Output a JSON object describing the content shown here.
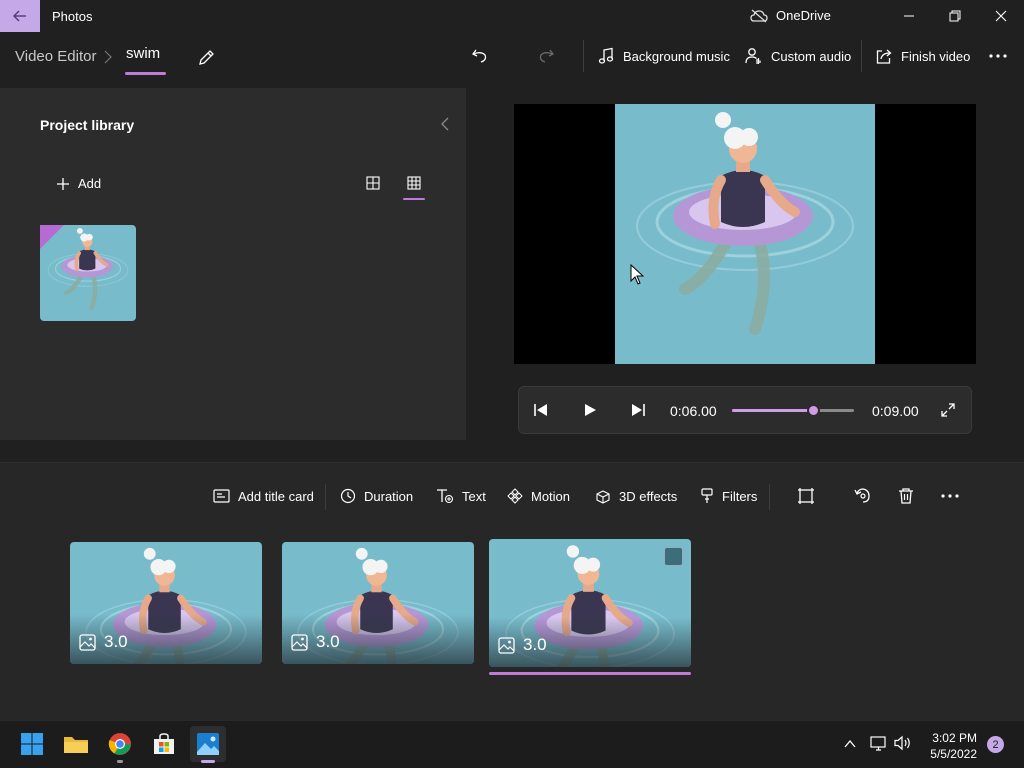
{
  "titlebar": {
    "app_title": "Photos",
    "onedrive_label": "OneDrive"
  },
  "breadcrumb": {
    "root": "Video Editor",
    "current": "swim"
  },
  "toolbar": {
    "background_music": "Background music",
    "custom_audio": "Custom audio",
    "finish_video": "Finish video"
  },
  "library": {
    "title": "Project library",
    "add_label": "Add"
  },
  "playback": {
    "current_time": "0:06.00",
    "total_time": "0:09.00",
    "progress": 0.667
  },
  "storyboard": {
    "tools": {
      "add_title_card": "Add title card",
      "duration": "Duration",
      "text": "Text",
      "motion": "Motion",
      "effects_3d": "3D effects",
      "filters": "Filters"
    },
    "clips": [
      {
        "duration": "3.0",
        "selected": false
      },
      {
        "duration": "3.0",
        "selected": false
      },
      {
        "duration": "3.0",
        "selected": true
      }
    ]
  },
  "taskbar": {
    "time": "3:02 PM",
    "date": "5/5/2022",
    "notification_count": "2"
  },
  "colors": {
    "accent": "#c07ad8",
    "accent_light": "#c5a8e8",
    "water": "#78bccc"
  }
}
